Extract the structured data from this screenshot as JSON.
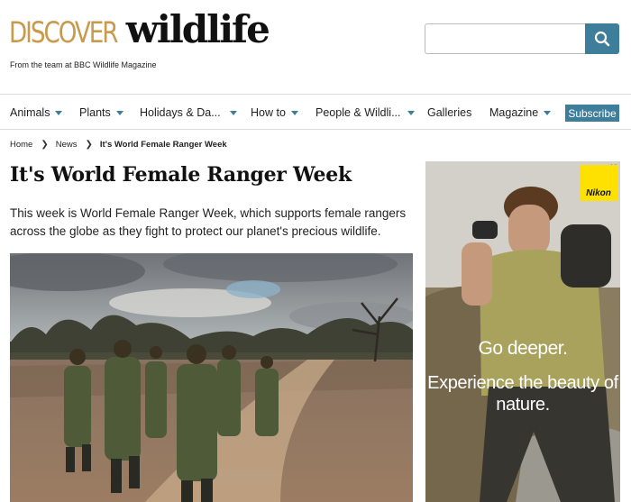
{
  "logo": {
    "discover": "DISCOVER",
    "wildlife": "wildlife"
  },
  "tagline": "From the team at BBC Wildlife Magazine",
  "search": {
    "placeholder": "",
    "value": ""
  },
  "nav": {
    "items": [
      {
        "label": "Animals",
        "dropdown": true
      },
      {
        "label": "Plants",
        "dropdown": true
      },
      {
        "label": "Holidays & Da...",
        "dropdown": true
      },
      {
        "label": "How to",
        "dropdown": true
      },
      {
        "label": "People & Wildli...",
        "dropdown": true
      },
      {
        "label": "Galleries",
        "dropdown": false
      },
      {
        "label": "Magazine",
        "dropdown": true
      }
    ],
    "subscribe": "Subscribe"
  },
  "breadcrumb": {
    "home": "Home",
    "news": "News",
    "current": "It's World Female Ranger Week"
  },
  "article": {
    "title": "It's World Female Ranger Week",
    "standfirst": "This week is World Female Ranger Week, which supports female rangers across the globe as they fight to protect our planet's precious wildlife."
  },
  "ad": {
    "adchoices": "✕",
    "brand": "Nikon",
    "line1": "Go deeper.",
    "line2": "Experience the beauty of nature."
  },
  "colors": {
    "accent": "#3e7e9a",
    "logo_gold": "#c89a4e",
    "nikon_yellow": "#ffe100"
  }
}
